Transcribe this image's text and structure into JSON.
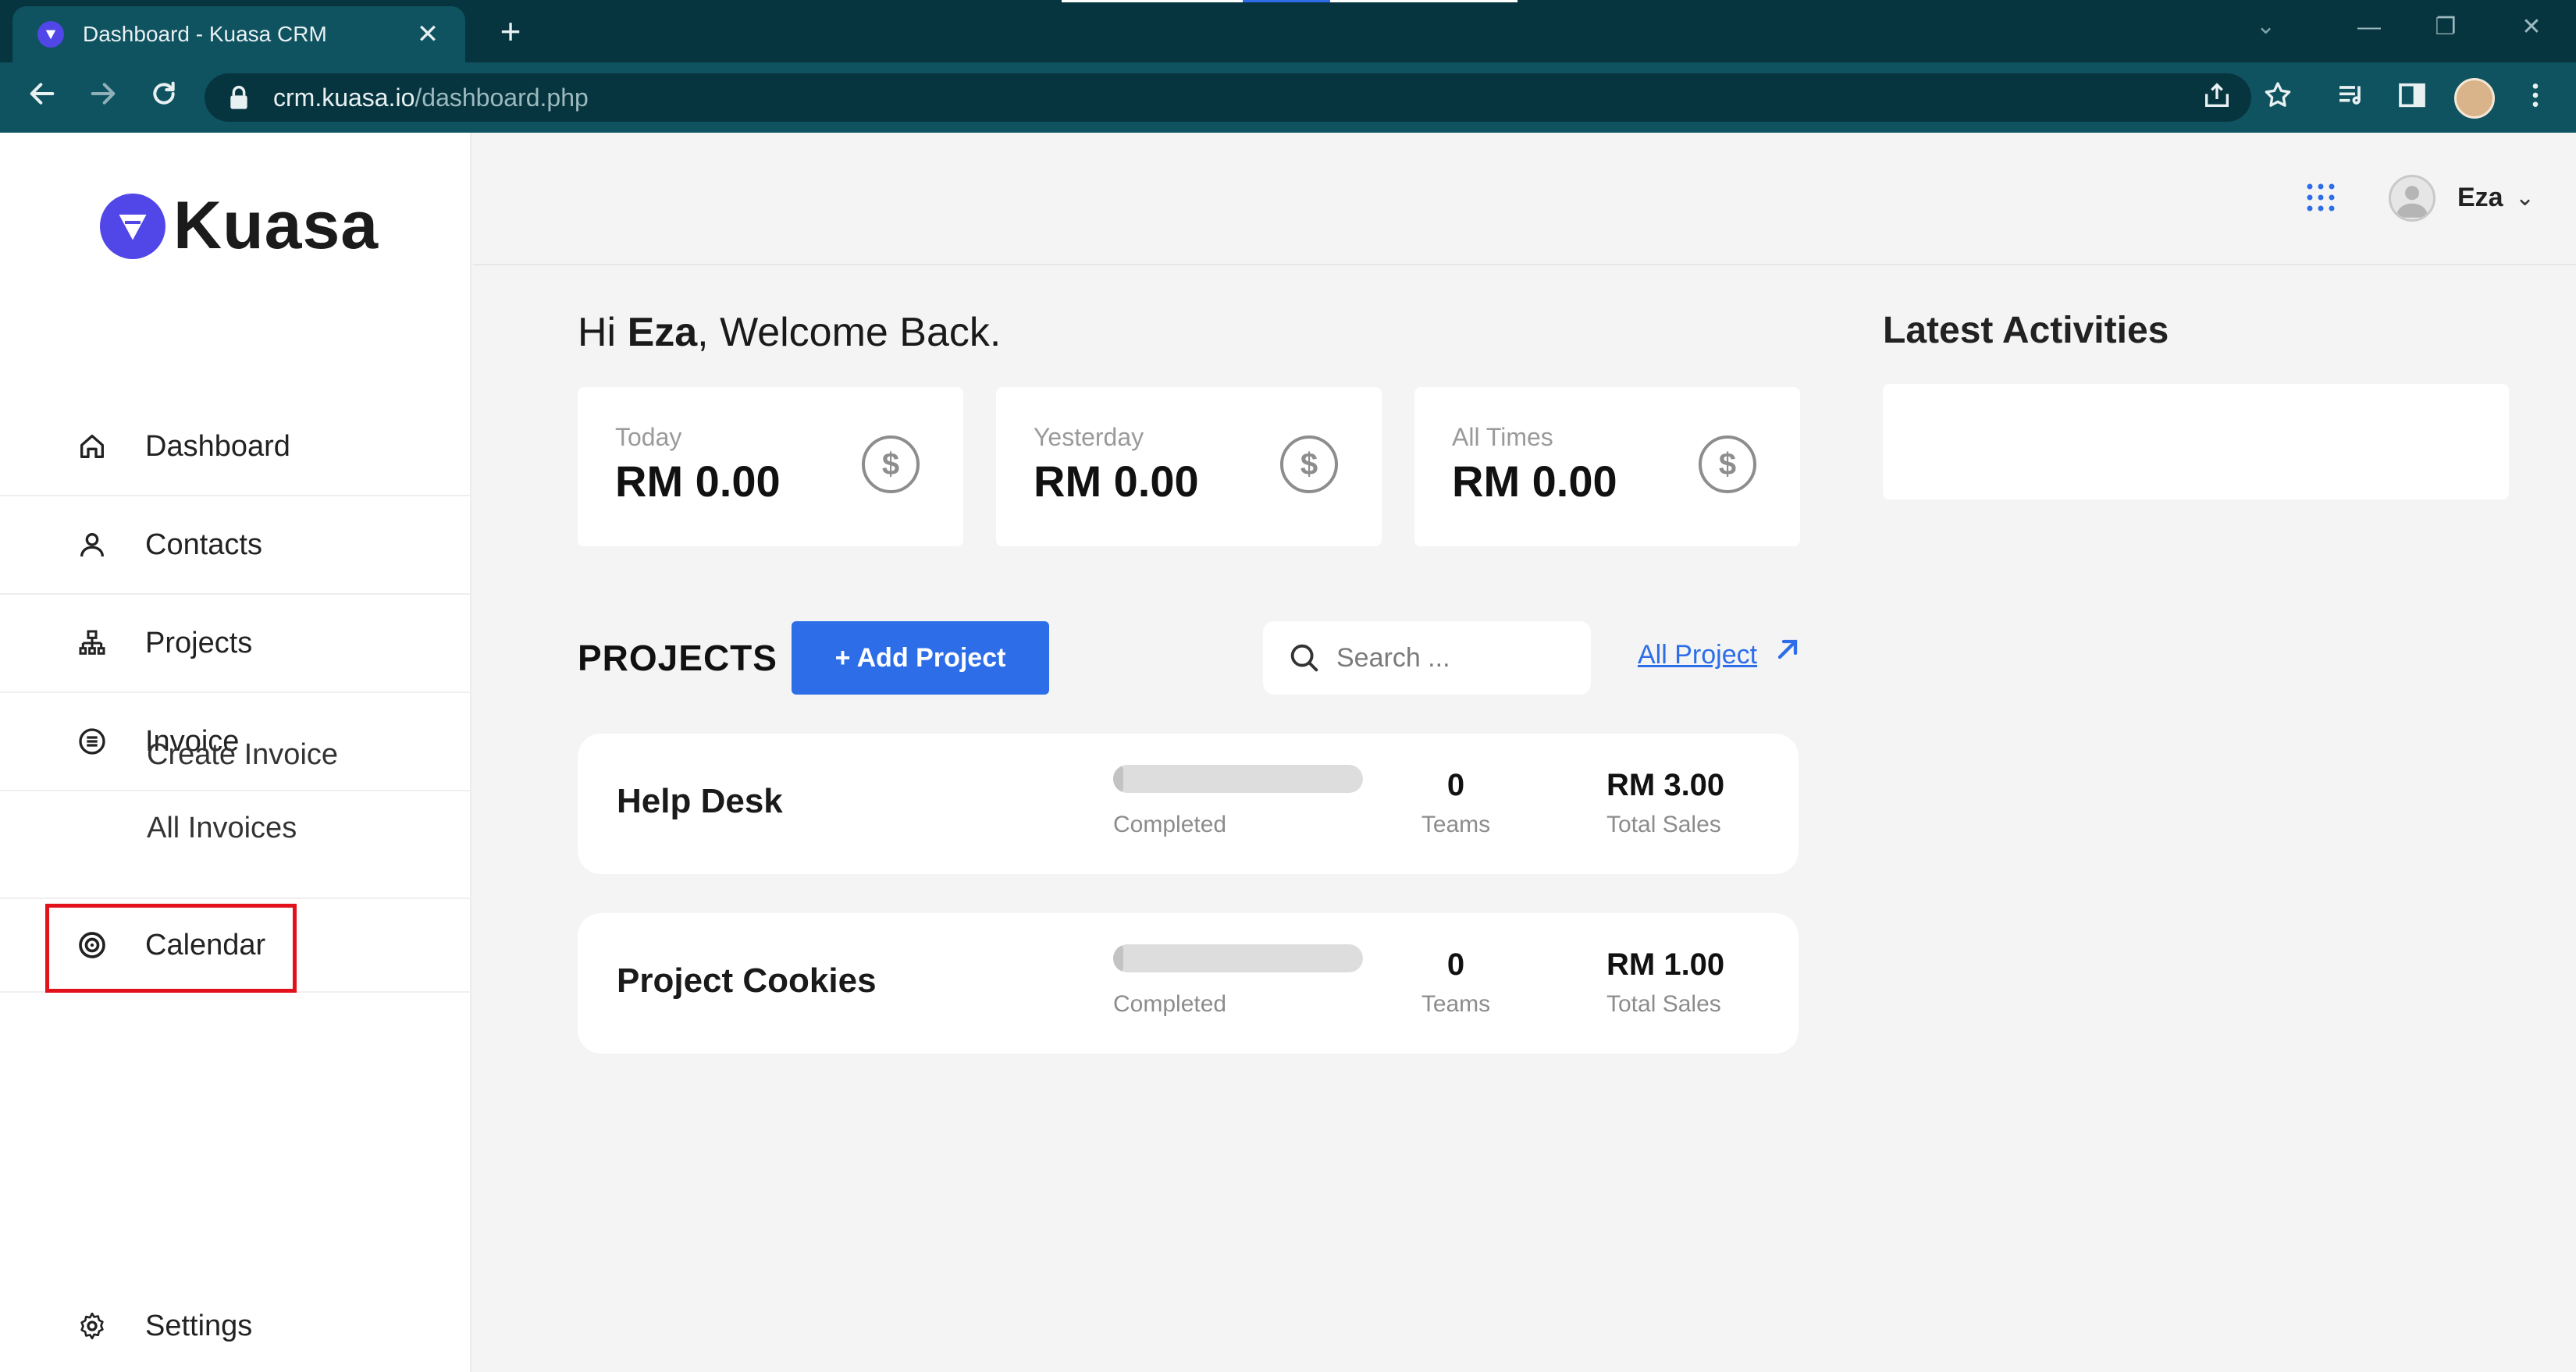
{
  "browser": {
    "tab_title": "Dashboard - Kuasa CRM",
    "tab_close": "✕",
    "new_tab": "+",
    "url_host": "crm.kuasa.io",
    "url_path": "/dashboard.php",
    "minimize": "—",
    "restore": "❐",
    "close": "✕",
    "tabs_menu": "⌄"
  },
  "sidebar": {
    "logo_text": "Kuasa",
    "items": [
      {
        "label": "Dashboard",
        "icon": "home-icon"
      },
      {
        "label": "Contacts",
        "icon": "user-icon"
      },
      {
        "label": "Projects",
        "icon": "hierarchy-icon"
      },
      {
        "label": "Invoice",
        "icon": "receipt-icon"
      }
    ],
    "subitems": [
      "Create Invoice",
      "All Invoices"
    ],
    "calendar": {
      "label": "Calendar",
      "icon": "calendar-icon"
    },
    "settings": {
      "label": "Settings",
      "icon": "gear-icon"
    }
  },
  "header": {
    "user_name": "Eza",
    "caret": "⌄"
  },
  "welcome": {
    "prefix": "Hi ",
    "name": "Eza",
    "suffix": ", Welcome Back."
  },
  "stats": [
    {
      "label": "Today",
      "value": "RM 0.00",
      "icon": "$"
    },
    {
      "label": "Yesterday",
      "value": "RM 0.00",
      "icon": "$"
    },
    {
      "label": "All Times",
      "value": "RM 0.00",
      "icon": "$"
    }
  ],
  "projects_section": {
    "heading": "PROJECTS",
    "add_label": "+ Add Project",
    "search_placeholder": "Search ...",
    "all_link": "All Project"
  },
  "projects": [
    {
      "name": "Help Desk",
      "completed_label": "Completed",
      "progress": 0.04,
      "teams": "0",
      "teams_label": "Teams",
      "sales": "RM 3.00",
      "sales_label": "Total Sales"
    },
    {
      "name": "Project Cookies",
      "completed_label": "Completed",
      "progress": 0.04,
      "teams": "0",
      "teams_label": "Teams",
      "sales": "RM 1.00",
      "sales_label": "Total Sales"
    }
  ],
  "latest": {
    "heading": "Latest Activities"
  },
  "colors": {
    "accent": "#2d6ee8",
    "brand": "#5146e8",
    "highlight": "#e3111c",
    "chrome": "#0f5260"
  }
}
